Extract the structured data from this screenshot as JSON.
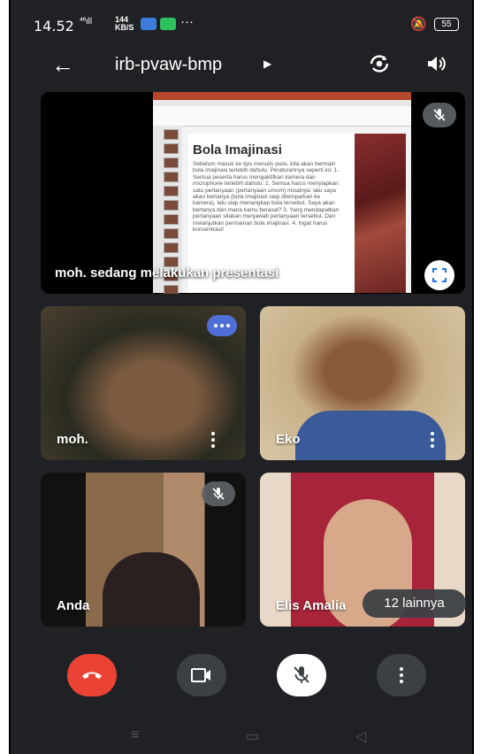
{
  "status_bar": {
    "time": "14.52",
    "signal": "⁴⁶ıll",
    "speed_value": "144",
    "speed_unit": "KB/S",
    "overflow": "···",
    "battery": "55"
  },
  "header": {
    "meeting_code": "irb-pvaw-bmp"
  },
  "presentation": {
    "caption": "moh. sedang melakukan presentasi",
    "slide_title": "Bola Imajinasi",
    "slide_text": "Sebelum masuk ke tips menulis puisi, kita akan bermain bola imajinasi terlebih dahulu. Peraturannya seperti ini: 1. Semua peserta harus mengaktifkan kamera dan microphone terlebih dahulu; 2. Semua harus menyiapkan satu pertanyaan (pertanyaan umum) misalnya: lalu saya akan bertanya (bola imajinasi siap dilemparkan ke kamera), lalu siap menangkap bola tersebut. Saya akan bertanya dan mana kamu berasal? 3. Yang mendapatkan pertanyaan silakan menjawab pertanyaan tersebut. Dan melanjutkan permainan bola imajinasi. 4. Ingat harus konsentrasi!"
  },
  "participants": [
    {
      "name": "moh.",
      "bg": "#3a3a2a"
    },
    {
      "name": "Eko",
      "bg": "#b89a6a"
    },
    {
      "name": "Anda",
      "bg": "#5a4a3a"
    },
    {
      "name": "Elis Amalia",
      "bg": "#a83a4a"
    }
  ],
  "others_chip": "12 lainnya",
  "colors": {
    "background": "#202124",
    "tile": "#3c4043",
    "end_call": "#ea4335",
    "control": "#3c4043",
    "more_options": "#4f6ed6"
  },
  "icons": {
    "back": "arrow-left-icon",
    "switch_camera": "switch-camera-icon",
    "speaker": "speaker-icon",
    "mic_off": "mic-off-icon",
    "fullscreen": "fullscreen-icon",
    "end_call": "hangup-icon",
    "camera": "video-camera-icon",
    "more": "more-vertical-icon"
  }
}
